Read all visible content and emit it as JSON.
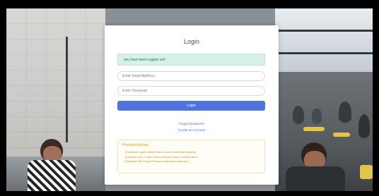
{
  "login": {
    "title": "Login",
    "alert_message": "you have been logged out!",
    "email_placeholder": "Enter Email Address...",
    "password_placeholder": "Enter Password",
    "login_button": "Login",
    "forgot_password_link": "Forgot Password?",
    "create_account_link": "Create an Account!"
  },
  "info": {
    "title": "Pemberitahuan",
    "items": [
      "Silahkan Login terlebih dahulu untuk membuat jawaban",
      "Silahkan klik Create an Account jika belum memiliki akun",
      "Silahkan klik Forgot Password jika lupa password"
    ]
  },
  "colors": {
    "primary": "#4e73df",
    "alert_bg": "#d6f2e6",
    "warning": "#e0a020"
  }
}
